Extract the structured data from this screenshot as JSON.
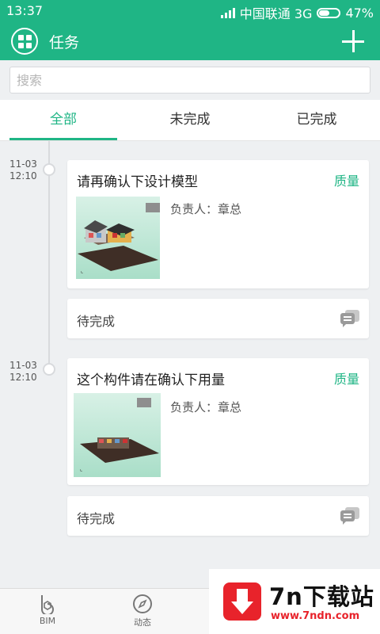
{
  "status_bar": {
    "time": "13:37",
    "carrier": "中国联通 3G",
    "battery": "47%",
    "battery_level": 0.47
  },
  "header": {
    "title": "任务",
    "apps_icon": "apps-grid-icon",
    "add_icon": "plus-icon"
  },
  "search": {
    "placeholder": "搜索"
  },
  "tabs": [
    {
      "label": "全部",
      "active": true
    },
    {
      "label": "未完成",
      "active": false
    },
    {
      "label": "已完成",
      "active": false
    }
  ],
  "tasks": [
    {
      "date": "11-03",
      "time": "12:10",
      "title": "请再确认下设计模型",
      "tag": "质量",
      "owner": "负责人：章总",
      "status": "待完成"
    },
    {
      "date": "11-03",
      "time": "12:10",
      "title": "这个构件请在确认下用量",
      "tag": "质量",
      "owner": "负责人：章总",
      "status": "待完成"
    }
  ],
  "bottom_nav": [
    {
      "label": "BIM",
      "icon": "bim-icon"
    },
    {
      "label": "动态",
      "icon": "compass-icon"
    }
  ],
  "watermark": {
    "name": "7n下载站",
    "url": "www.7ndn.com"
  },
  "colors": {
    "accent": "#1fb585",
    "background": "#eef0f2",
    "watermark_red": "#e8232b"
  }
}
